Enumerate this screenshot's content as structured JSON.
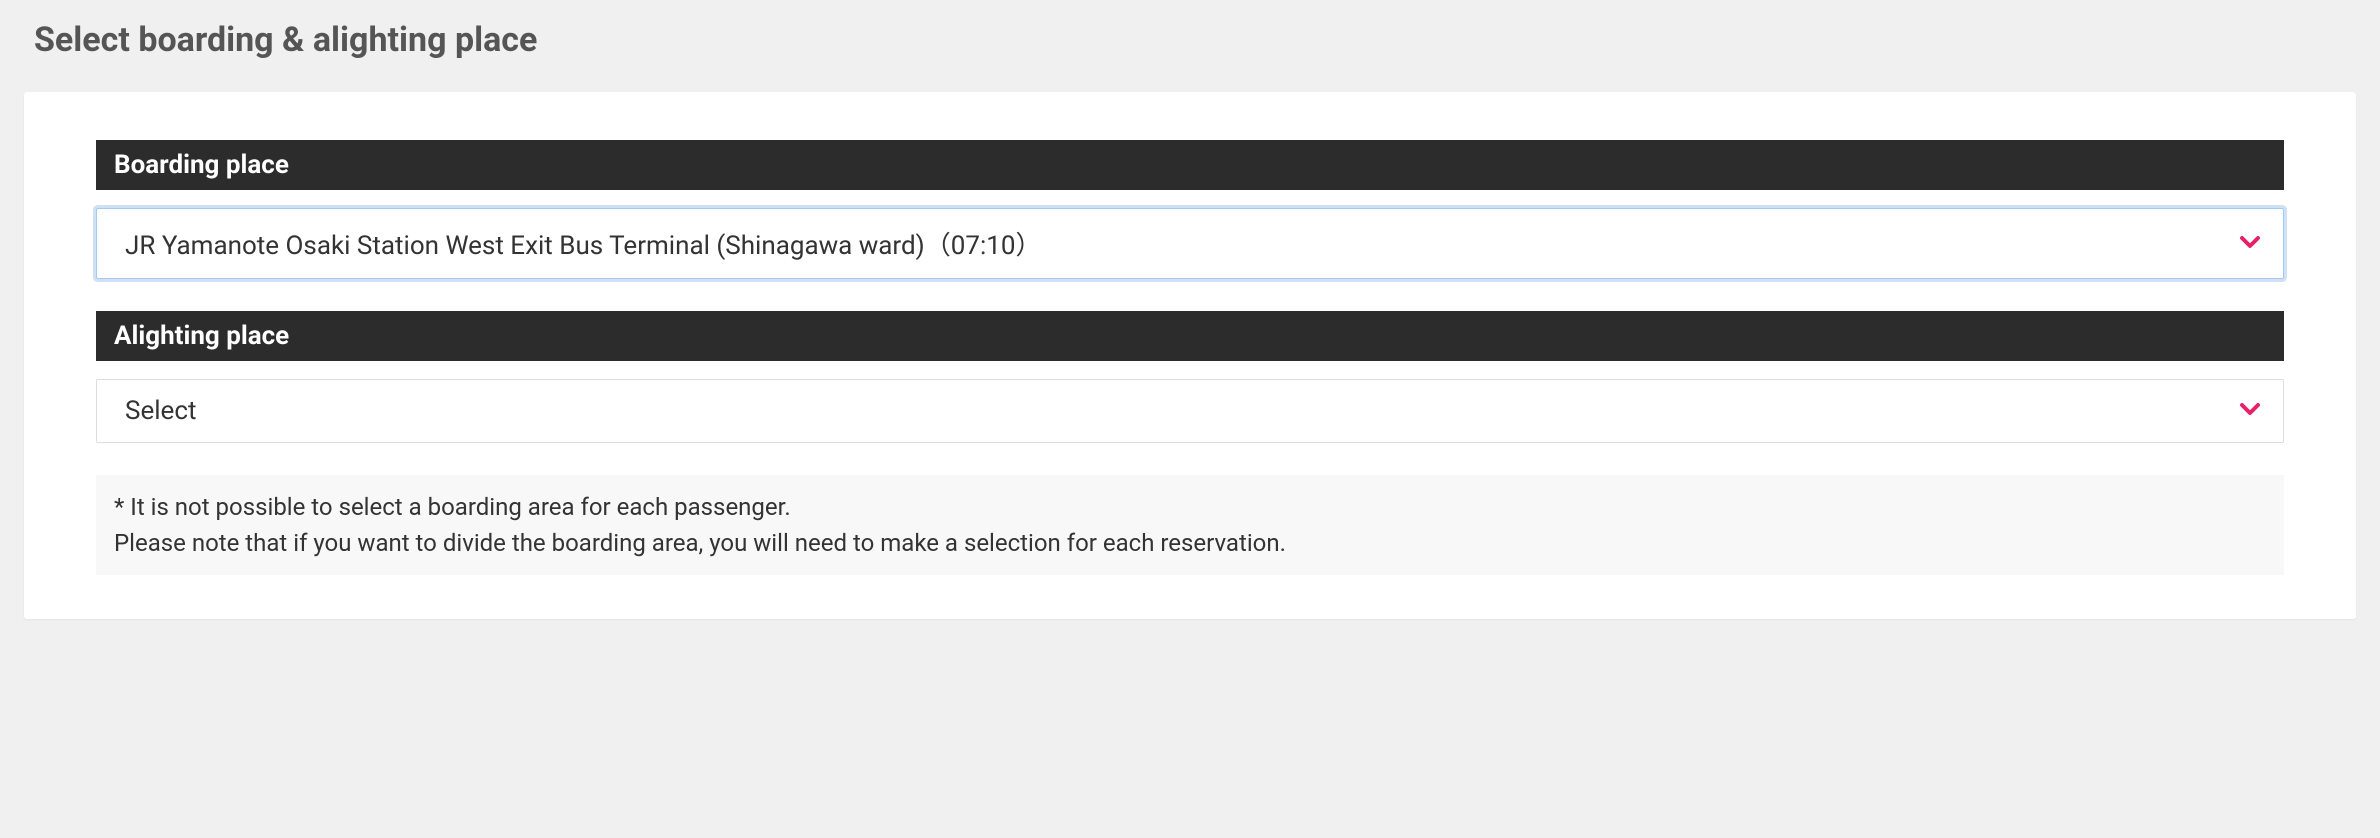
{
  "page": {
    "title": "Select boarding & alighting place"
  },
  "sections": {
    "boarding": {
      "header": "Boarding place",
      "selected": "JR Yamanote Osaki Station West Exit Bus Terminal (Shinagawa ward)（07:10）"
    },
    "alighting": {
      "header": "Alighting place",
      "selected": "Select"
    }
  },
  "note": {
    "line1": "* It is not possible to select a boarding area for each passenger.",
    "line2": "Please note that if you want to divide the boarding area, you will need to make a selection for each reservation."
  }
}
